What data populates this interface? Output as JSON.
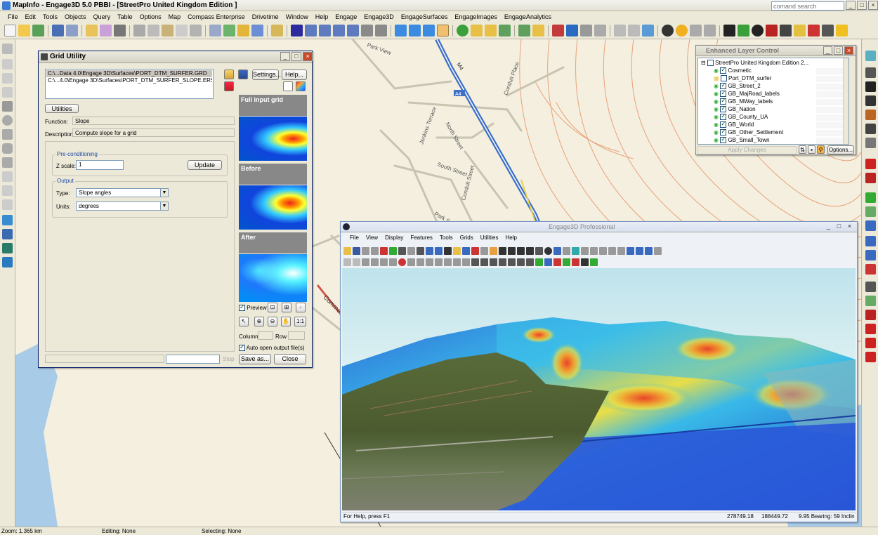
{
  "app": {
    "title": "MapInfo - Engage3D 5.0   PBBI - [StreetPro United Kingdom Edition ]",
    "search_placeholder": "comand search"
  },
  "menu": [
    "File",
    "Edit",
    "Tools",
    "Objects",
    "Query",
    "Table",
    "Options",
    "Map",
    "Compass Enterprise",
    "Drivetime",
    "Window",
    "Help",
    "Engage",
    "Engage3D",
    "EngageSurfaces",
    "EngageImages",
    "EngageAnalytics"
  ],
  "map": {
    "street_labels": [
      "Park View",
      "Jenkins Terrace",
      "North Street",
      "South Street",
      "Conduit Street",
      "Conduit Place",
      "Park S",
      "Comme"
    ],
    "road_badge": "M4",
    "badge_label": "A4"
  },
  "grid_utility": {
    "title": "Grid Utility",
    "files": [
      "C:\\...Data 4.0\\Engage 3D\\Surfaces\\PORT_DTM_SURFER.GRD",
      "C:\\...4.0\\Engage 3D\\Surfaces\\PORT_DTM_SURFER_SLOPE.ERS"
    ],
    "settings_label": "Settings...",
    "help_label": "Help...",
    "utilities_label": "Utilities",
    "function_label": "Function:",
    "function_value": "Slope",
    "description_label": "Description:",
    "description_value": "Compute slope for a grid",
    "precond_group": "Pre-conditioning",
    "zscale_label": "Z scale:",
    "zscale_value": "1",
    "update_label": "Update",
    "output_group": "Output",
    "type_label": "Type:",
    "type_value": "Slope angles",
    "units_label": "Units:",
    "units_value": "degrees",
    "panel_full": "Full input grid",
    "panel_before": "Before",
    "panel_after": "After",
    "preview_label": "Preview",
    "preview_checked": true,
    "column_label": "Column",
    "row_label": "Row",
    "auto_open_label": "Auto open output file(s)",
    "auto_open_checked": true,
    "stop_label": "Stop",
    "saveas_label": "Save as...",
    "close_label": "Close",
    "zoom_1_1": "1:1"
  },
  "layer_control": {
    "title": "Enhanced Layer Control",
    "root": "StreetPro United Kingdom Edition 2...",
    "layers": [
      {
        "name": "Cosmetic",
        "checked": true
      },
      {
        "name": "Port_DTM_surfer",
        "checked": false
      },
      {
        "name": "GB_Street_2",
        "checked": true
      },
      {
        "name": "GB_MajRoad_labels",
        "checked": true
      },
      {
        "name": "GB_MWay_labels",
        "checked": true
      },
      {
        "name": "GB_Nation",
        "checked": true
      },
      {
        "name": "GB_County_UA",
        "checked": true
      },
      {
        "name": "GB_World",
        "checked": true
      },
      {
        "name": "GB_Other_Settlement",
        "checked": true
      },
      {
        "name": "GB_Small_Town",
        "checked": true
      }
    ],
    "apply_label": "Apply Changes",
    "options_label": "Options..."
  },
  "engage3d": {
    "title": "Engage3D Professional",
    "menu": [
      "File",
      "View",
      "Display",
      "Features",
      "Tools",
      "Grids",
      "Utilities",
      "Help"
    ],
    "status_help": "For Help, press F1",
    "status_x": "278749.18",
    "status_y": "188449.72",
    "status_view": "9.95  Bearing: 59  Inclin"
  },
  "status": {
    "zoom": "Zoom: 1.365 km",
    "editing": "Editing: None",
    "selecting": "Selecting: None"
  },
  "colors": {
    "accent_titlebar": "#0a246a",
    "map_background": "#f4efdf",
    "water": "#a8cbe8",
    "motorway": "#3d6fc6",
    "contour": "#e9a27a"
  }
}
